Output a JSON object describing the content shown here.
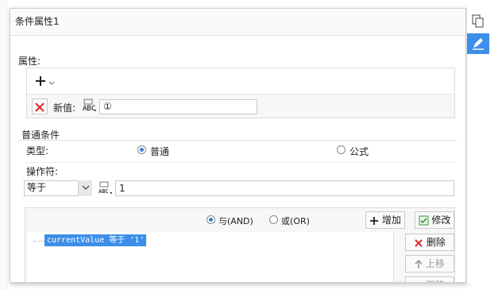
{
  "dialog": {
    "title": "条件属性1"
  },
  "properties": {
    "section_label": "属性:",
    "new_value_label": "新值:",
    "new_value_input": "①",
    "add_menu_icon": "plus-dropdown-icon"
  },
  "condition": {
    "section_label": "普通条件",
    "type_label": "类型:",
    "type_options": [
      "普通",
      "公式"
    ],
    "type_selected": "普通",
    "operator_label": "操作符:",
    "operator_value": "等于",
    "value_input": "1",
    "logic_options": [
      "与(AND)",
      "或(OR)"
    ],
    "logic_selected": "与(AND)",
    "add_button": "增加",
    "modify_button": "修改",
    "delete_button": "删除",
    "move_up_button": "上移",
    "move_down_button": "下移",
    "condition_list": [
      "currentValue 等于 '1'"
    ]
  },
  "sidebar": {
    "icons": [
      "copy-icon",
      "edit-icon"
    ]
  },
  "colors": {
    "accent": "#3d8ee8",
    "selection": "#3d8ee8",
    "delete_red": "#d9302c",
    "check_green": "#3a9b3a"
  }
}
